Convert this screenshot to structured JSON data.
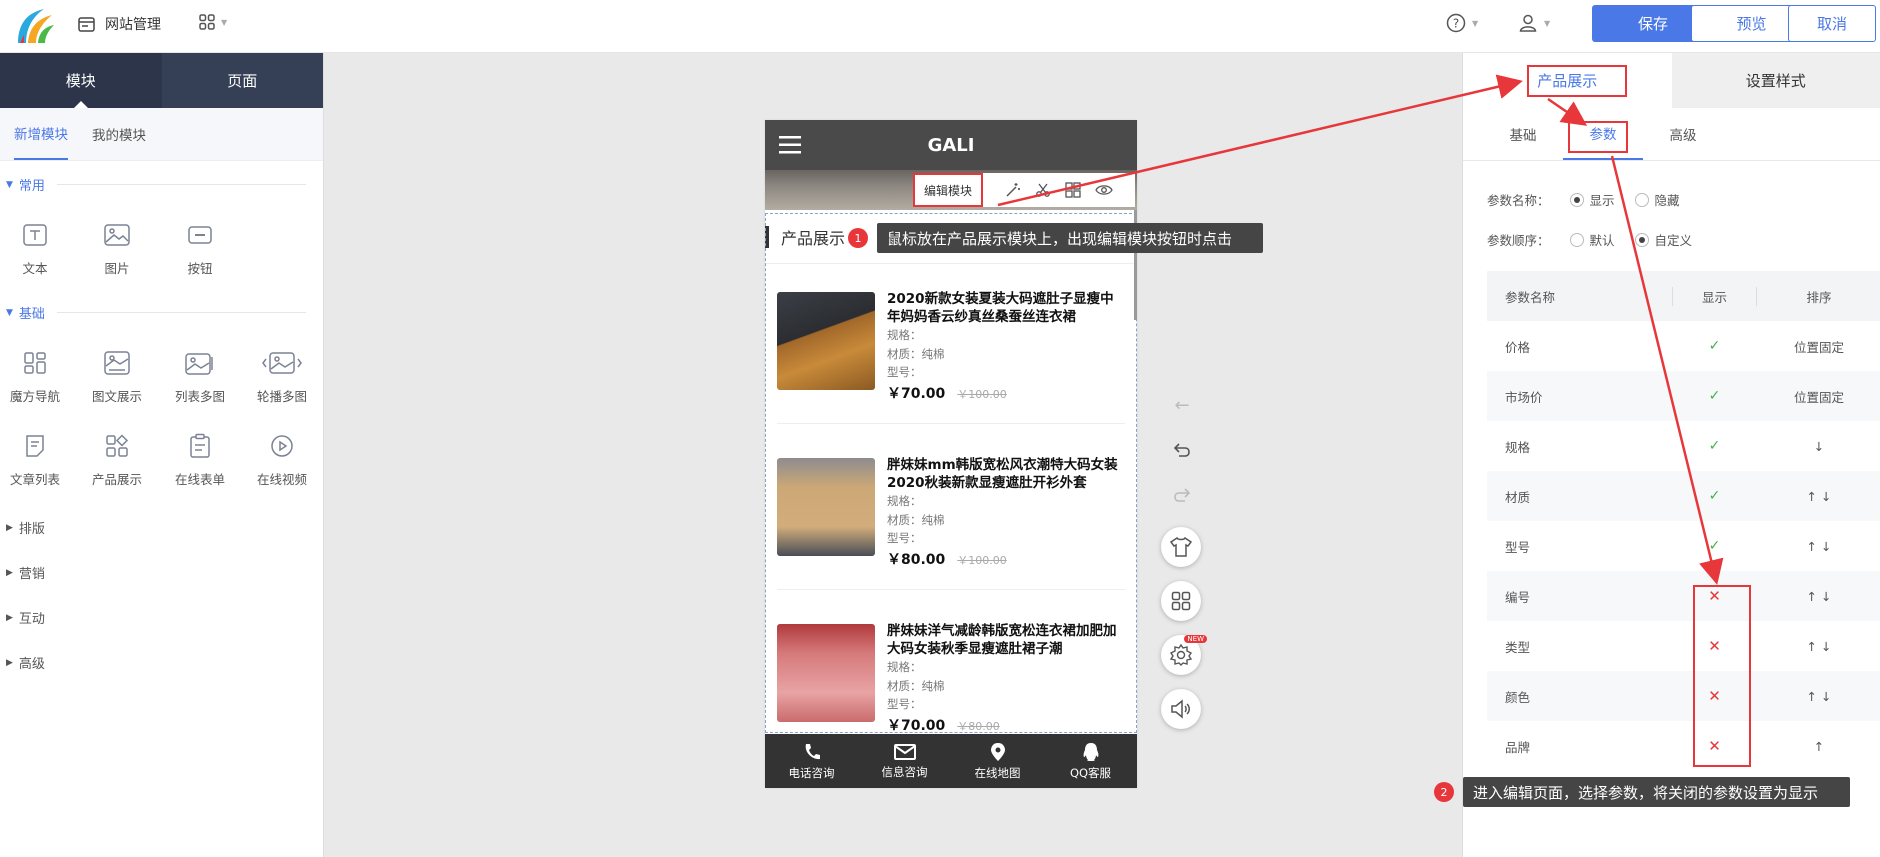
{
  "header": {
    "site_manage": "网站管理",
    "save": "保存",
    "preview": "预览",
    "cancel": "取消"
  },
  "left": {
    "tabs": [
      "模块",
      "页面"
    ],
    "subtabs": [
      "新增模块",
      "我的模块"
    ],
    "sections": {
      "common": "常用",
      "basic": "基础",
      "layout": "排版",
      "marketing": "营销",
      "interact": "互动",
      "advanced": "高级"
    },
    "common_modules": [
      "文本",
      "图片",
      "按钮"
    ],
    "basic_modules": [
      "魔方导航",
      "图文展示",
      "列表多图",
      "轮播多图",
      "文章列表",
      "产品展示",
      "在线表单",
      "在线视频"
    ]
  },
  "phone": {
    "title": "GALI",
    "edit_module": "编辑模块",
    "section_title": "产品展示",
    "products": [
      {
        "name": "2020新款女装夏装大码遮肚子显瘦中年妈妈香云纱真丝桑蚕丝连衣裙",
        "spec": "规格：",
        "material": "材质：纯棉",
        "model": "型号：",
        "price": "￥70.00",
        "old_price": "￥100.00"
      },
      {
        "name": "胖妹妹mm韩版宽松风衣潮特大码女装2020秋装新款显瘦遮肚开衫外套",
        "spec": "规格：",
        "material": "材质：纯棉",
        "model": "型号：",
        "price": "￥80.00",
        "old_price": "￥100.00"
      },
      {
        "name": "胖妹妹洋气减龄韩版宽松连衣裙加肥加大码女装秋季显瘦遮肚裙子潮",
        "spec": "规格：",
        "material": "材质：纯棉",
        "model": "型号：",
        "price": "￥70.00",
        "old_price": "￥80.00"
      }
    ],
    "footer": [
      "电话咨询",
      "信息咨询",
      "在线地图",
      "QQ客服"
    ]
  },
  "annotations": {
    "tip1_num": "1",
    "tip1": "鼠标放在产品展示模块上，出现编辑模块按钮时点击",
    "tip2_num": "2",
    "tip2": "进入编辑页面，选择参数，将关闭的参数设置为显示"
  },
  "fab": {
    "new_tag": "NEW"
  },
  "right": {
    "tabs": [
      "产品展示",
      "设置样式"
    ],
    "subtabs": [
      "基础",
      "参数",
      "高级"
    ],
    "param_name_label": "参数名称：",
    "param_name_options": [
      "显示",
      "隐藏"
    ],
    "param_order_label": "参数顺序：",
    "param_order_options": [
      "默认",
      "自定义"
    ],
    "table_headers": [
      "参数名称",
      "显示",
      "排序"
    ],
    "rows": [
      {
        "name": "价格",
        "show": "✓",
        "order": "位置固定"
      },
      {
        "name": "市场价",
        "show": "✓",
        "order": "位置固定"
      },
      {
        "name": "规格",
        "show": "✓",
        "order": "↓"
      },
      {
        "name": "材质",
        "show": "✓",
        "order": "↑ ↓"
      },
      {
        "name": "型号",
        "show": "✓",
        "order": "↑ ↓"
      },
      {
        "name": "编号",
        "show": "✕",
        "order": "↑ ↓"
      },
      {
        "name": "类型",
        "show": "✕",
        "order": "↑ ↓"
      },
      {
        "name": "颜色",
        "show": "✕",
        "order": "↑ ↓"
      },
      {
        "name": "品牌",
        "show": "✕",
        "order": "↑"
      }
    ]
  },
  "colors": {
    "accent": "#4a78e6",
    "highlight_red": "#e8373a",
    "dark_nav": "#353f55"
  }
}
